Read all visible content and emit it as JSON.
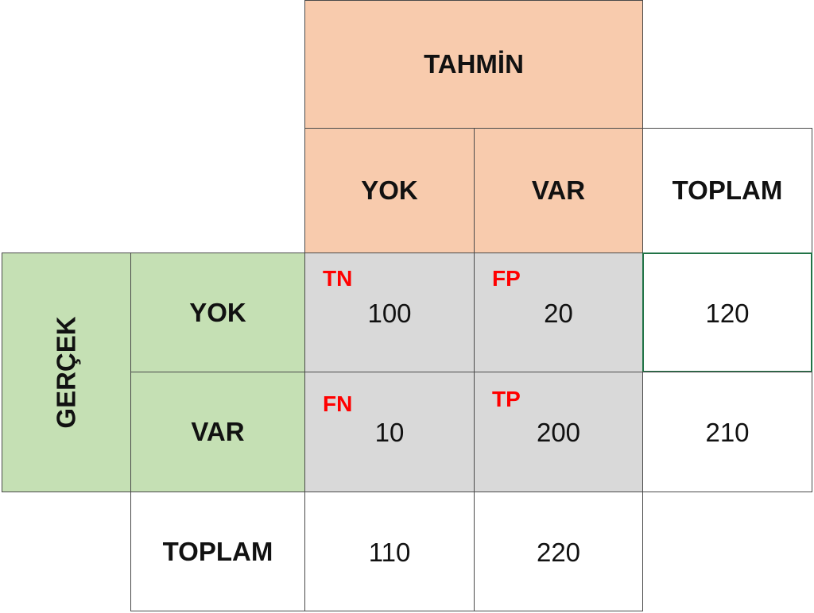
{
  "header": {
    "predicted_label": "TAHMİN",
    "predicted_no": "YOK",
    "predicted_yes": "VAR",
    "total_label": "TOPLAM"
  },
  "side": {
    "actual_label": "GERÇEK",
    "actual_no": "YOK",
    "actual_yes": "VAR"
  },
  "matrix": {
    "tn_tag": "TN",
    "tn_value": "100",
    "fp_tag": "FP",
    "fp_value": "20",
    "fn_tag": "FN",
    "fn_value": "10",
    "tp_tag": "TP",
    "tp_value": "200"
  },
  "totals": {
    "row_no_total": "120",
    "row_yes_total": "210",
    "bottom_label": "TOPLAM",
    "col_no_total": "110",
    "col_yes_total": "220"
  },
  "colors": {
    "predicted_fill": "#f8cbad",
    "actual_fill": "#c5e0b4",
    "matrix_fill": "#d9d9d9",
    "tag_color": "#ff0000",
    "selection_border": "#217346"
  }
}
